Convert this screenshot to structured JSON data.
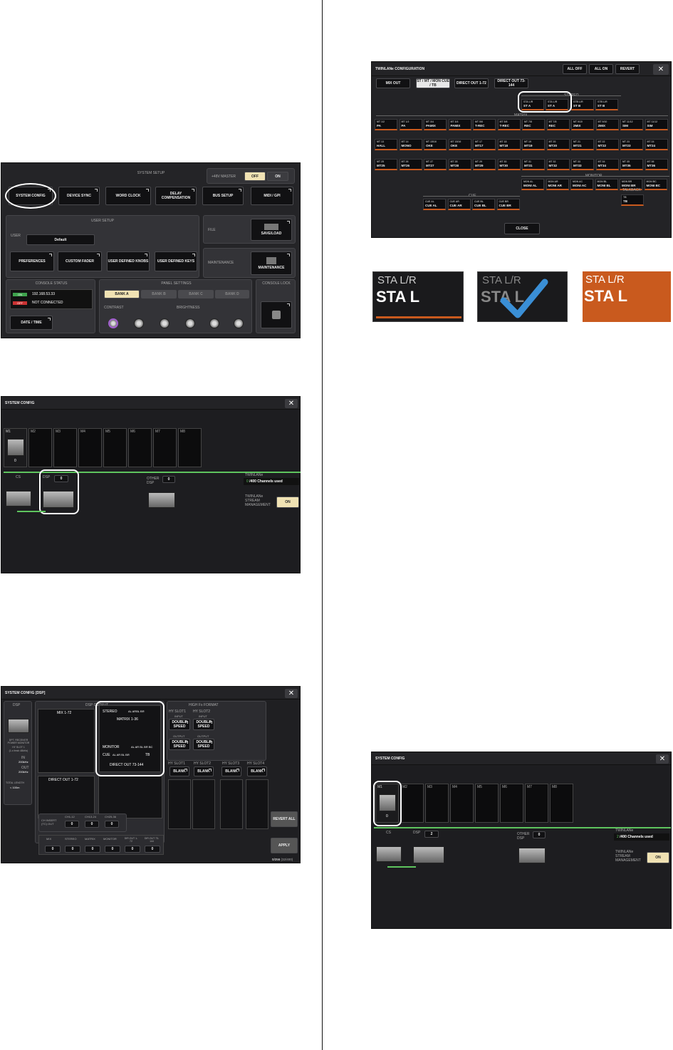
{
  "sys_setup": {
    "section_title": "SYSTEM SETUP",
    "master_label": "+48V MASTER",
    "off_label": "OFF",
    "on_label": "ON",
    "buttons": [
      "SYSTEM CONFIG",
      "DEVICE SYNC",
      "WORD CLOCK",
      "DELAY COMPENSATION",
      "BUS SETUP",
      "MIDI / GPI"
    ],
    "user_setup_title": "USER SETUP",
    "user_label": "USER",
    "user_value": "Default",
    "file_label": "FILE",
    "save_load": "SAVE/LOAD",
    "user_buttons": [
      "PREFERENCES",
      "CUSTOM FADER",
      "USER DEFINED KNOBS",
      "USER DEFINED KEYS"
    ],
    "maintenance_label": "MAINTENANCE",
    "maintenance_button": "MAINTENANCE",
    "console_status_title": "CONSOLE STATUS",
    "ip_tag": "ON",
    "ip": "192.168.53.33",
    "conn_tag": "OFF",
    "conn": "NOT CONNECTED",
    "date_time": "DATE / TIME",
    "panel_settings_title": "PANEL SETTINGS",
    "banks": [
      "BANK A",
      "BANK B",
      "BANK C",
      "BANK D"
    ],
    "contrast_label": "CONTRAST",
    "brightness_label": "BRIGHTNESS",
    "console_lock_title": "CONSOLE LOCK"
  },
  "sys_config": {
    "title": "SYSTEM CONFIG",
    "close": "✕",
    "slots": [
      "M1",
      "M2",
      "M3",
      "M4",
      "M5",
      "M6",
      "M7",
      "M8"
    ],
    "m1_count": "0",
    "cs_label": "CS",
    "dsp_label": "DSP",
    "dsp_value": "0",
    "other_dsp_label": "OTHER DSP",
    "other_dsp_value": "0",
    "twinlane_label": "TWINLANe",
    "twinlane_used": "0",
    "twinlane_text": "/400 Channels used",
    "stream_label": "TWINLANe STREAM MANAGEMENT",
    "stream_on": "ON"
  },
  "dsp_config": {
    "title": "SYSTEM CONFIG [DSP]",
    "close": "✕",
    "dsp_label": "DSP",
    "dsp_output_label": "DSP OUTPUT",
    "mix_label": "MIX 1-72",
    "stereo_label": "STEREO",
    "stereo_side": "AL ARBL BR",
    "matrix_label": "MATRIX 1-36",
    "monitor_label": "MONITOR",
    "monitor_side": "AL AR BL BR BC",
    "cue_label": "CUE",
    "cue_side": "AL AR BL BR",
    "tb_label": "TB",
    "direct_out_1_label": "DIRECT OUT 1-72",
    "direct_out_73_label": "DIRECT OUT 73-144",
    "hifs_title": "HIGH Fs FORMAT",
    "hy_slots": [
      "HY SLOT1",
      "HY SLOT2"
    ],
    "input_label": "INPUT",
    "output_label": "OUTPUT",
    "double_speed": "DOUBLE SPEED",
    "hy_slot_lower": [
      "HY SLOT1",
      "HY SLOT2",
      "HY SLOT3",
      "HY SLOT4"
    ],
    "blank": "BLANK",
    "ch_insert_label": "CH INSERT (TC) OUT",
    "ch_insert_tabs": [
      "CH1-12",
      "CH13-24",
      "CH25-36"
    ],
    "ch_insert_vals": [
      "0",
      "0",
      "0"
    ],
    "bottom_labels": [
      "MIX",
      "STEREO",
      "MATRIX",
      "MONITOR",
      "DIR.OUT 1-72",
      "DIR.OUT 73-144"
    ],
    "bottom_vals": [
      "0",
      "0",
      "0",
      "0",
      "0",
      "0"
    ],
    "revert_all": "REVERT ALL",
    "apply": "APPLY",
    "count_text": "0/256",
    "count_text2": "(32/400)",
    "mini_labels": [
      "DPT. RECEIVER POWER MONITOR",
      "HY SLOT 1",
      "(1.x fresh 48kHz)",
      "IN",
      "OUT",
      "TOTAL LENGTH"
    ],
    "mini_in": "200kHz",
    "mini_out": "200kHz",
    "mini_len": "< 100m"
  },
  "twinlane": {
    "title": "TWINLANe CONFIGURATION",
    "top_buttons": [
      "ALL OFF",
      "ALL ON",
      "REVERT"
    ],
    "close": "✕",
    "tabs": [
      "MIX OUT",
      "ST / MT / MON CUE / TB",
      "DIRECT OUT 1-72",
      "DIRECT OUT 73-144"
    ],
    "stereo_label": "STEREO",
    "stereo": [
      [
        "STA L/R",
        "ST A"
      ],
      [
        "STA L/R",
        "ST A"
      ],
      [
        "STB L/R",
        "ST B"
      ],
      [
        "STB L/R",
        "ST B"
      ]
    ],
    "matrix_label": "MATRIX",
    "row1": [
      [
        "MT 1/2",
        "PA"
      ],
      [
        "MT 1/2",
        "PA"
      ],
      [
        "MT 3/4",
        "PAMIX"
      ],
      [
        "MT 3/4",
        "PAMIX"
      ],
      [
        "MT 5/6",
        "T-REC"
      ],
      [
        "MT 5/6",
        "T-REC"
      ],
      [
        "MT 7/8",
        "REC"
      ],
      [
        "MT 7/8",
        "REC"
      ],
      [
        "MT 9/10",
        "2MIX"
      ],
      [
        "MT 9/10",
        "2MIX"
      ],
      [
        "MT 11/12",
        "SIM"
      ],
      [
        "MT 11/12",
        "SIM"
      ]
    ],
    "row2": [
      [
        "MT 13",
        "HALL"
      ],
      [
        "MT 14",
        "MONO"
      ],
      [
        "MT 15/16",
        "OKE"
      ],
      [
        "MT 15/16",
        "OKE"
      ],
      [
        "MT 17",
        "MT17"
      ],
      [
        "MT 18",
        "MT18"
      ],
      [
        "MT 19",
        "MT19"
      ],
      [
        "MT 20",
        "MT20"
      ],
      [
        "MT 21",
        "MT21"
      ],
      [
        "MT 22",
        "MT22"
      ],
      [
        "MT 23",
        "MT23"
      ],
      [
        "MT 24",
        "MT24"
      ]
    ],
    "row3": [
      [
        "MT 25",
        "MT25"
      ],
      [
        "MT 26",
        "MT26"
      ],
      [
        "MT 27",
        "MT27"
      ],
      [
        "MT 28",
        "MT28"
      ],
      [
        "MT 29",
        "MT29"
      ],
      [
        "MT 30",
        "MT30"
      ],
      [
        "MT 31",
        "MT31"
      ],
      [
        "MT 32",
        "MT32"
      ],
      [
        "MT 33",
        "MT33"
      ],
      [
        "MT 34",
        "MT34"
      ],
      [
        "MT 35",
        "MT35"
      ],
      [
        "MT 36",
        "MT36"
      ]
    ],
    "monitor_label": "MONITOR",
    "monitor": [
      [
        "MON AL",
        "MONI AL"
      ],
      [
        "MON AR",
        "MONI AR"
      ],
      [
        "MON AC",
        "MONI AC"
      ],
      [
        "MON BL",
        "MONI BL"
      ],
      [
        "MON BR",
        "MONI BR"
      ],
      [
        "MON BC",
        "MONI BC"
      ]
    ],
    "cue_label": "CUE",
    "cue": [
      [
        "CUE AL",
        "CUE AL"
      ],
      [
        "CUE AR",
        "CUE AR"
      ],
      [
        "CUE BL",
        "CUE BL"
      ],
      [
        "CUE BR",
        "CUE BR"
      ]
    ],
    "talkback_label": "TALKBACK",
    "talkback": [
      "TB",
      "TB"
    ],
    "close_button": "CLOSE"
  },
  "states": [
    {
      "top": "STA L/R",
      "main": "STA L"
    },
    {
      "top": "STA L/R",
      "main": "STA L"
    },
    {
      "top": "STA L/R",
      "main": "STA L"
    }
  ],
  "sys_config2": {
    "title": "SYSTEM CONFIG",
    "close": "✕",
    "slots": [
      "M1",
      "M2",
      "M3",
      "M4",
      "M5",
      "M6",
      "M7",
      "M8"
    ],
    "m1_count": "0",
    "cs_label": "CS",
    "dsp_label": "DSP",
    "dsp_value": "2",
    "other_dsp_label": "OTHER DSP",
    "other_dsp_value": "0",
    "twinlane_label": "TWINLANe",
    "twinlane_used": "2",
    "twinlane_text": "/400 Channels used",
    "stream_label": "TWINLANe STREAM MANAGEMENT",
    "stream_on": "ON"
  },
  "colors": {
    "orange": "#c95a1e",
    "green": "#5ec45e",
    "check": "#3a8fd6"
  }
}
